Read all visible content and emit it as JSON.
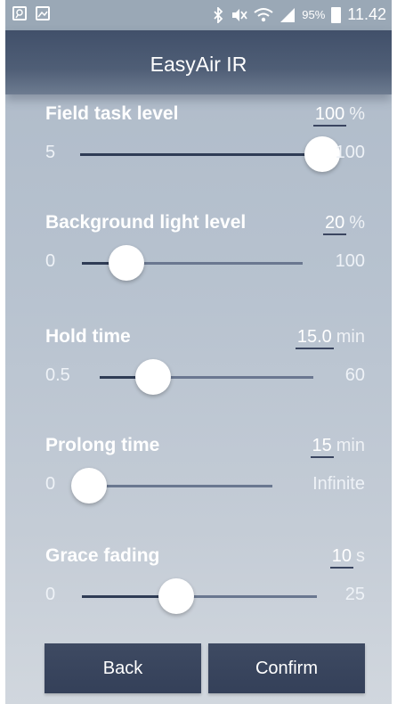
{
  "status_bar": {
    "battery": "95%",
    "time": "11.42"
  },
  "app": {
    "title": "EasyAir IR"
  },
  "settings": [
    {
      "label": "Field task level",
      "value": "100",
      "unit": "%",
      "min": "5",
      "max": "100",
      "level": 1.0
    },
    {
      "label": "Background light level",
      "value": "20",
      "unit": "%",
      "min": "0",
      "max": "100",
      "level": 0.2
    },
    {
      "label": "Hold time",
      "value": "15.0",
      "unit": "min",
      "min": "0.5",
      "max": "60",
      "level": 0.25
    },
    {
      "label": "Prolong time",
      "value": "15",
      "unit": "min",
      "min": "0",
      "max": "Infinite",
      "level": 0.0
    },
    {
      "label": "Grace fading",
      "value": "10",
      "unit": "s",
      "min": "0",
      "max": "25",
      "level": 0.4
    }
  ],
  "buttons": {
    "back": "Back",
    "confirm": "Confirm"
  }
}
